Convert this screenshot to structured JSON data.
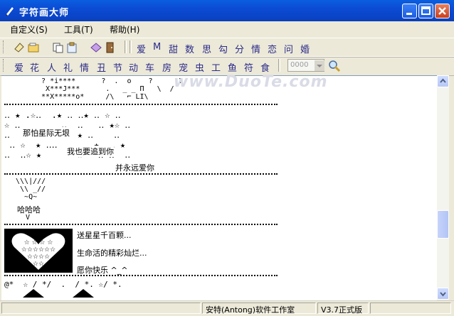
{
  "window": {
    "title": "字符画大师"
  },
  "menu": [
    {
      "label": "自定义(S)"
    },
    {
      "label": "工具(T)"
    },
    {
      "label": "帮助(H)"
    }
  ],
  "toolbar1": {
    "chars": [
      "爱",
      "M",
      "甜",
      "数",
      "思",
      "勾",
      "分",
      "情",
      "恋",
      "问",
      "婚"
    ]
  },
  "toolbar2": {
    "chars": [
      "爱",
      "花",
      "人",
      "礼",
      "情",
      "丑",
      "节",
      "动",
      "车",
      "房",
      "宠",
      "虫",
      "工",
      "鱼",
      "符",
      "食"
    ],
    "combo_value": "0000"
  },
  "art": {
    "top": "  ? *i****      ?  .  o    ?      ?\n   X***J***      .   _ _ П   \\  /\n  **X*****o*     /\\   ⌐ LI\\    ",
    "stars_bg": "‥ ★ .☆‥  .★ ‥ ‥★ ‥ ☆ ‥\n☆ ‥        ‥  ‥   ‥ ★☆ ‥\n‥       ☆  ‥  ★ ‥    ‥\n ‥ ☆  ★ ‥‥   ‥   ★  ‥ ★\n‥  ‥☆ ★       ☆   ‥ ‥  ‥",
    "star_texts": [
      "那怕星际无垠",
      "我也要追到你",
      "并永远爱你"
    ],
    "face": " \\\\\\|///\n  \\\\ _//\n   ~Q~",
    "face_text": "哈哈哈",
    "face_v": "V",
    "bottom_line": "@*  ☆ / */  .  / *. ☆/ *."
  },
  "heart_messages": [
    "送星星千百颗...",
    "生命活的精彩灿烂...",
    "愿你快乐  ^_^"
  ],
  "watermark": "www.DuoTe.com",
  "status": {
    "company": "安特(Antong)软件工作室",
    "version": "V3.7正式版"
  }
}
